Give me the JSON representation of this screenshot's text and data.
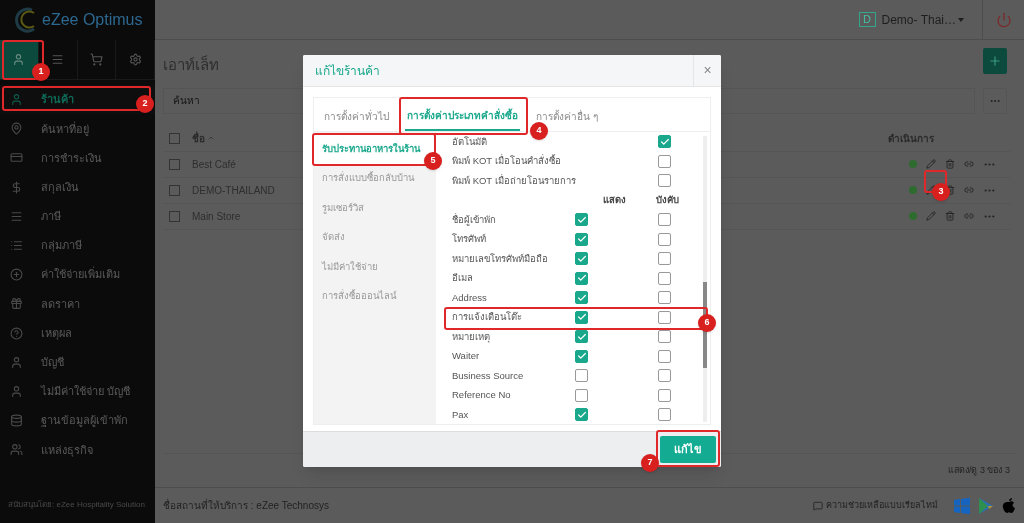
{
  "app": {
    "logo_text": "eZee Optimus"
  },
  "sidebar": {
    "tabs": [
      {
        "selected": true
      },
      {
        "selected": false
      },
      {
        "selected": false
      },
      {
        "selected": false
      }
    ],
    "items": [
      {
        "label": "ร้านค้า",
        "selected": true
      },
      {
        "label": "ค้นหาที่อยู่",
        "selected": false
      },
      {
        "label": "การชำระเงิน",
        "selected": false
      },
      {
        "label": "สกุลเงิน",
        "selected": false
      },
      {
        "label": "ภาษี",
        "selected": false
      },
      {
        "label": "กลุ่มภาษี",
        "selected": false
      },
      {
        "label": "ค่าใช้จ่ายเพิ่มเติม",
        "selected": false
      },
      {
        "label": "ลดราคา",
        "selected": false
      },
      {
        "label": "เหตุผล",
        "selected": false
      },
      {
        "label": "บัญชี",
        "selected": false
      },
      {
        "label": "ไม่มีค่าใช้จ่าย บัญชี",
        "selected": false
      },
      {
        "label": "ฐานข้อมูลผู้เข้าพัก",
        "selected": false
      },
      {
        "label": "แหล่งธุรกิจ",
        "selected": false
      }
    ],
    "footer": "สนับสนุนโดย: eZee Hospitality Solution"
  },
  "header": {
    "property_initial": "D",
    "property_name": "Demo- Thai…"
  },
  "page": {
    "title": "เอาท์เล็ท",
    "search": {
      "placeholder": "ค้นหา"
    },
    "table": {
      "columns": [
        "ชื่อ",
        "ดำเนินการ"
      ],
      "select_all": {
        "checked": false
      },
      "rows": [
        {
          "name": "Best Café",
          "color": "#2e6b2e",
          "checked": false
        },
        {
          "name": "DEMO-THAILAND",
          "color": "#2e6b2e",
          "checked": false
        },
        {
          "name": "Main Store",
          "color": "#2e6b2e",
          "checked": false
        }
      ]
    },
    "pagination": "แสดง/ดู 3 ของ 3"
  },
  "status_bar": {
    "provider": "ชื่อสถานที่ให้บริการ : eZee Technosys",
    "help": "ความช่วยเหลือแบบเรียลไทม์"
  },
  "modal": {
    "title": "แก้ไขร้านค้า",
    "close": "×",
    "tabs": [
      {
        "label": "การตั้งค่าทั่วไป",
        "selected": false
      },
      {
        "label": "การตั้งค่าประเภทคำสั่งซื้อ",
        "selected": true
      },
      {
        "label": "การตั้งค่าอื่น ๆ",
        "selected": false
      }
    ],
    "order_types": [
      {
        "label": "รับประทานอาหารในร้าน",
        "selected": true
      },
      {
        "label": "การสั่งแบบซื้อกลับบ้าน",
        "selected": false
      },
      {
        "label": "รูมเซอร์วิส",
        "selected": false
      },
      {
        "label": "จัดส่ง",
        "selected": false
      },
      {
        "label": "ไม่มีค่าใช้จ่าย",
        "selected": false
      },
      {
        "label": "การสั่งซื้อออนไลน์",
        "selected": false
      }
    ],
    "options": [
      {
        "label": "อัตโนมัติ",
        "checked": true
      },
      {
        "label": "พิมพ์ KOT เมื่อโอนคำสั่งซื้อ",
        "checked": false
      },
      {
        "label": "พิมพ์ KOT เมื่อถ่ายโอนรายการ",
        "checked": false
      }
    ],
    "field_columns": [
      "แสดง",
      "บังคับ"
    ],
    "fields": [
      {
        "label": "ชื่อผู้เข้าพัก",
        "show": true,
        "required": false
      },
      {
        "label": "โทรศัพท์",
        "show": true,
        "required": false
      },
      {
        "label": "หมายเลขโทรศัพท์มือถือ",
        "show": true,
        "required": false
      },
      {
        "label": "อีเมล",
        "show": true,
        "required": false
      },
      {
        "label": "Address",
        "show": true,
        "required": false
      },
      {
        "label": "การแจ้งเตือนโต๊ะ",
        "show": true,
        "required": false
      },
      {
        "label": "หมายเหตุ",
        "show": true,
        "required": false
      },
      {
        "label": "Waiter",
        "show": true,
        "required": false
      },
      {
        "label": "Business Source",
        "show": false,
        "required": false
      },
      {
        "label": "Reference No",
        "show": false,
        "required": false
      },
      {
        "label": "Pax",
        "show": true,
        "required": false
      }
    ],
    "save_button": "แก้ไข"
  },
  "annotations": [
    "1",
    "2",
    "3",
    "4",
    "5",
    "6",
    "7"
  ]
}
